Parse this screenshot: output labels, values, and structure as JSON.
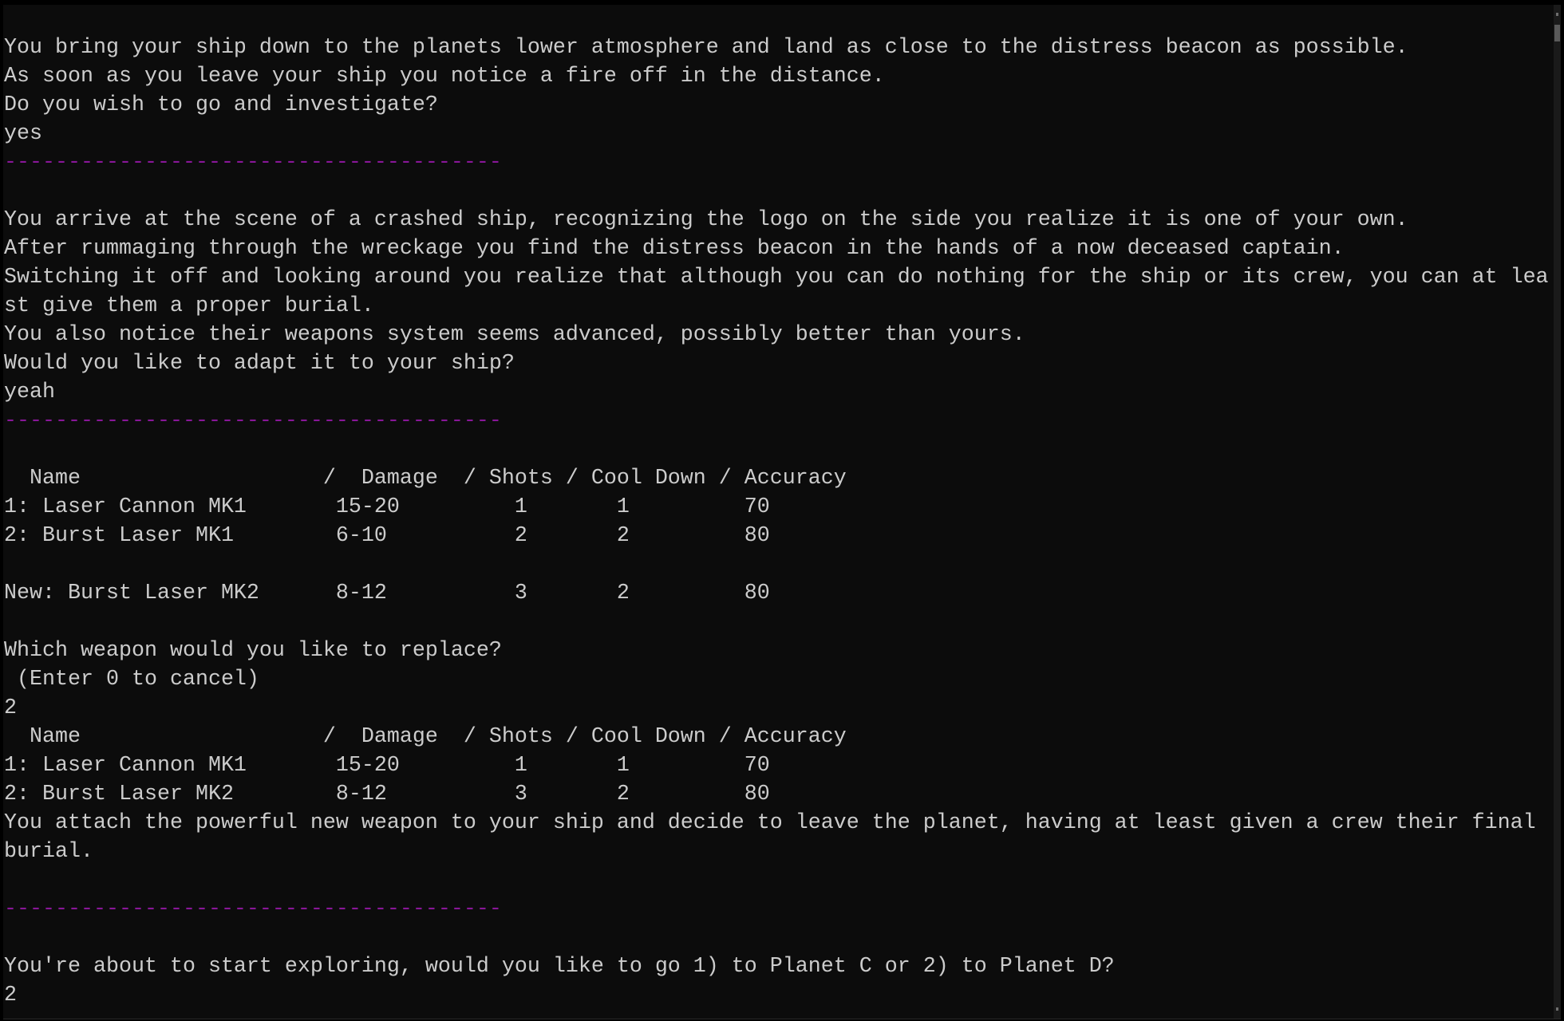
{
  "terminal": {
    "colors": {
      "background": "#0c0c0c",
      "foreground": "#cccccc",
      "separator": "#881798"
    },
    "lines": [
      {
        "text": "",
        "type": "text"
      },
      {
        "text": "You bring your ship down to the planets lower atmosphere and land as close to the distress beacon as possible.",
        "type": "text"
      },
      {
        "text": "As soon as you leave your ship you notice a fire off in the distance.",
        "type": "text"
      },
      {
        "text": "Do you wish to go and investigate?",
        "type": "prompt"
      },
      {
        "text": "yes",
        "type": "input"
      },
      {
        "text": "---------------------------------------",
        "type": "separator"
      },
      {
        "text": "",
        "type": "text"
      },
      {
        "text": "You arrive at the scene of a crashed ship, recognizing the logo on the side you realize it is one of your own.",
        "type": "text"
      },
      {
        "text": "After rummaging through the wreckage you find the distress beacon in the hands of a now deceased captain.",
        "type": "text"
      },
      {
        "text": "Switching it off and looking around you realize that although you can do nothing for the ship or its crew, you can at lea",
        "type": "text"
      },
      {
        "text": "st give them a proper burial.",
        "type": "text"
      },
      {
        "text": "You also notice their weapons system seems advanced, possibly better than yours.",
        "type": "text"
      },
      {
        "text": "Would you like to adapt it to your ship?",
        "type": "prompt"
      },
      {
        "text": "yeah",
        "type": "input"
      },
      {
        "text": "---------------------------------------",
        "type": "separator"
      },
      {
        "text": "",
        "type": "text"
      },
      {
        "text": "  Name                   /  Damage  / Shots / Cool Down / Accuracy",
        "type": "table-header"
      },
      {
        "text": "1: Laser Cannon MK1       15-20         1       1         70",
        "type": "table-row"
      },
      {
        "text": "2: Burst Laser MK1        6-10          2       2         80",
        "type": "table-row"
      },
      {
        "text": "",
        "type": "text"
      },
      {
        "text": "New: Burst Laser MK2      8-12          3       2         80",
        "type": "table-row"
      },
      {
        "text": "",
        "type": "text"
      },
      {
        "text": "Which weapon would you like to replace?",
        "type": "prompt"
      },
      {
        "text": " (Enter 0 to cancel)",
        "type": "text"
      },
      {
        "text": "2",
        "type": "input"
      },
      {
        "text": "  Name                   /  Damage  / Shots / Cool Down / Accuracy",
        "type": "table-header"
      },
      {
        "text": "1: Laser Cannon MK1       15-20         1       1         70",
        "type": "table-row"
      },
      {
        "text": "2: Burst Laser MK2        8-12          3       2         80",
        "type": "table-row"
      },
      {
        "text": "You attach the powerful new weapon to your ship and decide to leave the planet, having at least given a crew their final",
        "type": "text"
      },
      {
        "text": "burial.",
        "type": "text"
      },
      {
        "text": "",
        "type": "text"
      },
      {
        "text": "---------------------------------------",
        "type": "separator"
      },
      {
        "text": "",
        "type": "text"
      },
      {
        "text": "You're about to start exploring, would you like to go 1) to Planet C or 2) to Planet D?",
        "type": "prompt"
      },
      {
        "text": "2",
        "type": "input"
      }
    ]
  },
  "weapons": {
    "columns": [
      "Name",
      "Damage",
      "Shots",
      "Cool Down",
      "Accuracy"
    ],
    "before": [
      {
        "slot": "1",
        "name": "Laser Cannon MK1",
        "damage": "15-20",
        "shots": "1",
        "cooldown": "1",
        "accuracy": "70"
      },
      {
        "slot": "2",
        "name": "Burst Laser MK1",
        "damage": "6-10",
        "shots": "2",
        "cooldown": "2",
        "accuracy": "80"
      }
    ],
    "new": {
      "slot": "New",
      "name": "Burst Laser MK2",
      "damage": "8-12",
      "shots": "3",
      "cooldown": "2",
      "accuracy": "80"
    },
    "after": [
      {
        "slot": "1",
        "name": "Laser Cannon MK1",
        "damage": "15-20",
        "shots": "1",
        "cooldown": "1",
        "accuracy": "70"
      },
      {
        "slot": "2",
        "name": "Burst Laser MK2",
        "damage": "8-12",
        "shots": "3",
        "cooldown": "2",
        "accuracy": "80"
      }
    ]
  },
  "scrollbar": {
    "position": "top"
  }
}
